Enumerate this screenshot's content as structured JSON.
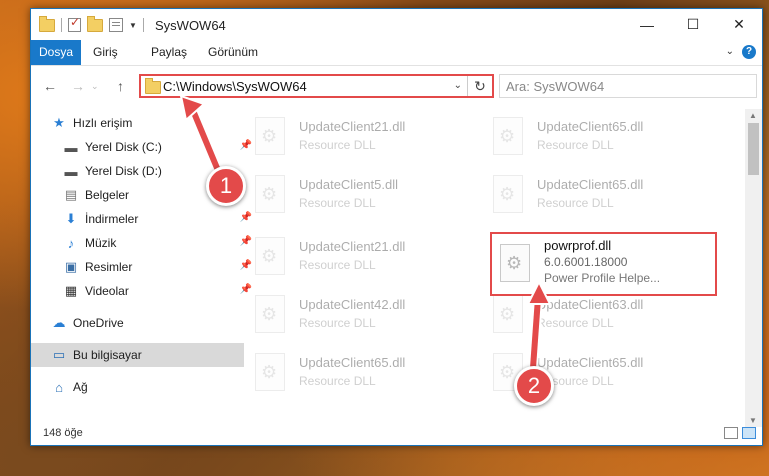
{
  "window": {
    "title": "SysWOW64",
    "controls": {
      "minimize": "—",
      "maximize": "☐",
      "close": "✕"
    }
  },
  "ribbon": {
    "tabs": [
      "Dosya",
      "Giriş",
      "Paylaş",
      "Görünüm"
    ],
    "help": "?"
  },
  "navigation": {
    "back": "←",
    "forward": "→",
    "up": "↑",
    "address": "C:\\Windows\\SysWOW64",
    "search_placeholder": "Ara: SysWOW64"
  },
  "sidebar": {
    "items": [
      {
        "label": "Hızlı erişim",
        "icon": "star-icon"
      },
      {
        "label": "Yerel Disk (C:)",
        "icon": "drive-icon"
      },
      {
        "label": "Yerel Disk (D:)",
        "icon": "drive-icon"
      },
      {
        "label": "Belgeler",
        "icon": "documents-icon"
      },
      {
        "label": "İndirmeler",
        "icon": "download-icon"
      },
      {
        "label": "Müzik",
        "icon": "music-icon"
      },
      {
        "label": "Resimler",
        "icon": "pictures-icon"
      },
      {
        "label": "Videolar",
        "icon": "video-icon"
      },
      {
        "label": "OneDrive",
        "icon": "cloud-icon"
      },
      {
        "label": "Bu bilgisayar",
        "icon": "computer-icon"
      },
      {
        "label": "Ağ",
        "icon": "network-icon"
      }
    ]
  },
  "files": [
    {
      "name": "UpdateClient21.dll",
      "type": "Resource DLL"
    },
    {
      "name": "UpdateClient65.dll",
      "type": "Resource DLL"
    },
    {
      "name": "UpdateClient5.dll",
      "type": "Resource DLL"
    },
    {
      "name": "UpdateClient65.dll",
      "type": "Resource DLL"
    },
    {
      "name": "UpdateClient21.dll",
      "type": "Resource DLL"
    },
    {
      "name": "powrprof.dll",
      "version": "6.0.6001.18000",
      "description": "Power Profile Helpe..."
    },
    {
      "name": "UpdateClient42.dll",
      "type": "Resource DLL"
    },
    {
      "name": "UpdateClient63.dll",
      "type": "Resource DLL"
    },
    {
      "name": "UpdateClient65.dll",
      "type": "Resource DLL"
    },
    {
      "name": "UpdateClient65.dll",
      "type": "Resource DLL"
    }
  ],
  "status": {
    "item_count": "148 öğe"
  },
  "callouts": [
    "1",
    "2"
  ],
  "colors": {
    "accent": "#1979ca",
    "highlight": "#e34a4a"
  }
}
